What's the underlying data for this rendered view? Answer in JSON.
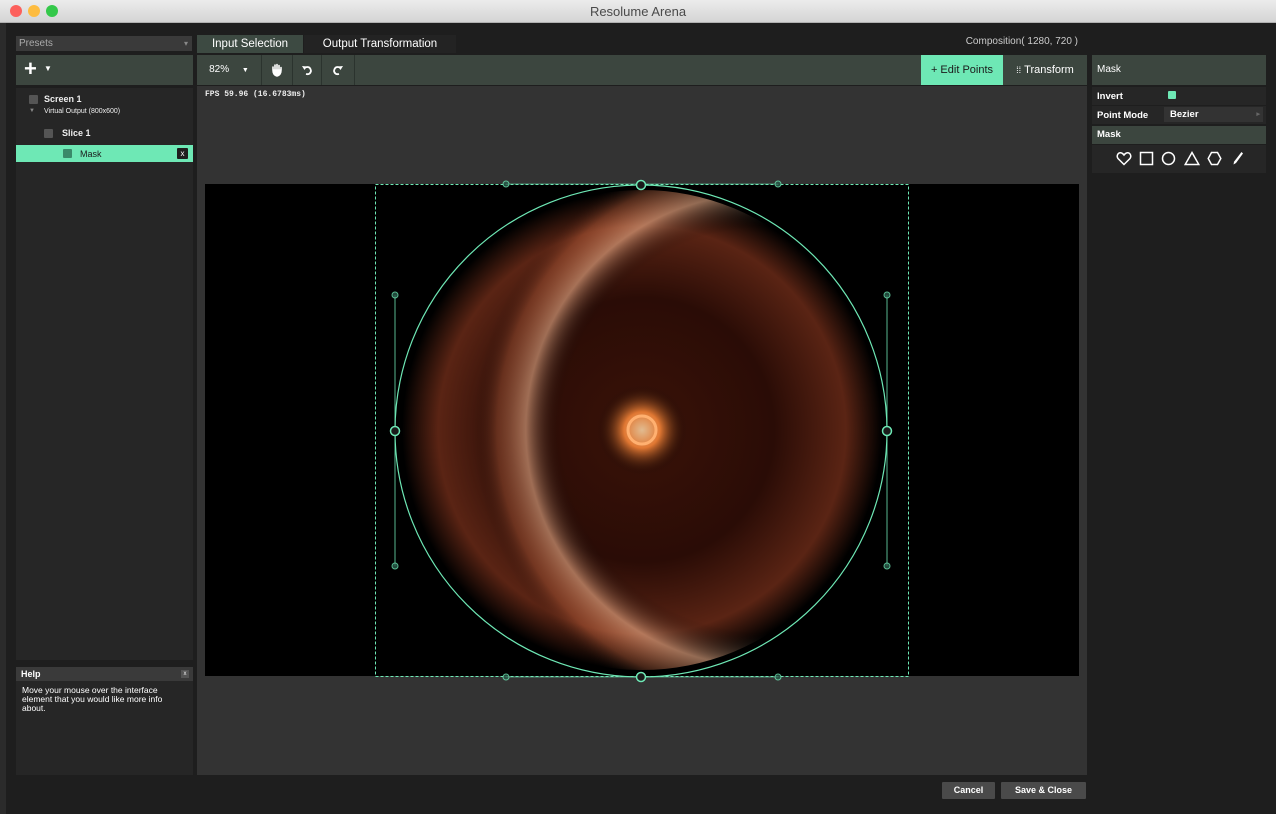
{
  "window": {
    "title": "Resolume Arena",
    "traffic_light_colors": [
      "#fc605c",
      "#fdbc40",
      "#34c84a"
    ]
  },
  "left_panel": {
    "presets_label": "Presets",
    "add_icon": "plus-icon",
    "tree": [
      {
        "label": "Screen 1"
      },
      {
        "label": "Virtual Output (800x600)"
      },
      {
        "label": "Slice 1"
      },
      {
        "label": "Mask",
        "selected": true,
        "remove_label": "x"
      }
    ]
  },
  "help": {
    "title": "Help",
    "close_label": "x",
    "body": "Move your mouse over the interface element that you would like more info about."
  },
  "tabs": [
    {
      "label": "Input Selection",
      "active": false
    },
    {
      "label": "Output Transformation",
      "active": true
    }
  ],
  "composition_label": "Composition( 1280, 720 )",
  "toolbar": {
    "zoom": "82%",
    "zoom_caret": "▼",
    "tools": [
      "hand-icon",
      "undo-icon",
      "redo-icon"
    ],
    "edit_points_label": "+ Edit Points",
    "transform_label": "Transform"
  },
  "canvas": {
    "fps": "FPS 59.96 (16.6783ms)"
  },
  "right_panel": {
    "header": "Mask",
    "invert_label": "Invert",
    "invert_checked": true,
    "point_mode_label": "Point Mode",
    "point_mode_value": "Bezier",
    "mask_section_label": "Mask",
    "shape_tools": [
      "heart-icon",
      "square-icon",
      "circle-icon",
      "triangle-icon",
      "hexagon-icon",
      "pen-icon"
    ]
  },
  "footer": {
    "cancel_label": "Cancel",
    "save_close_label": "Save & Close"
  },
  "colors": {
    "accent": "#6ee8b5",
    "panel_header": "#3c463f"
  }
}
